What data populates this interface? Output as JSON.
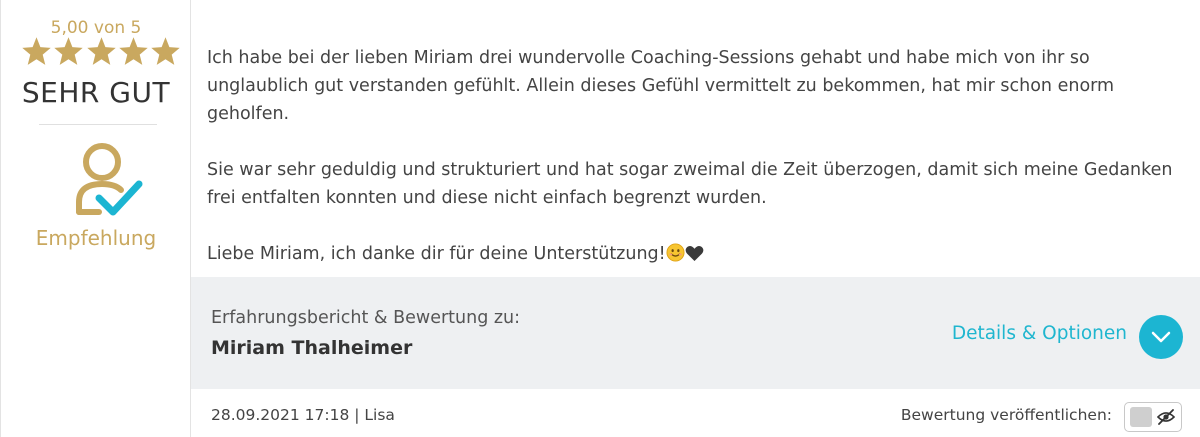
{
  "rating": {
    "score_text": "5,00 von 5",
    "stars": 5,
    "verdict": "SEHR GUT",
    "recommendation_label": "Empfehlung",
    "accent_color": "#c9a85f"
  },
  "review": {
    "paragraphs": [
      "Ich habe bei der lieben Miriam drei wundervolle Coaching-Sessions gehabt und habe mich von ihr so unglaublich gut verstanden gefühlt. Allein dieses Gefühl vermittelt zu bekommen, hat mir schon enorm geholfen.",
      "Sie war sehr geduldig und strukturiert und hat sogar zweimal die Zeit überzogen, damit sich meine Gedanken frei entfalten konnten und diese nicht einfach begrenzt wurden.",
      "Liebe Miriam, ich danke dir für deine Unterstützung!"
    ],
    "emoji_1": "smiling-face-emoji",
    "emoji_2": "heart-icon"
  },
  "panel": {
    "caption": "Erfahrungsbericht & Bewertung zu:",
    "name": "Miriam Thalheimer",
    "details_label": "Details & Optionen",
    "accent_color": "#1cb5d2"
  },
  "footer": {
    "meta": "28.09.2021 17:18 | Lisa",
    "publish_label": "Bewertung veröffentlichen:",
    "toggle_icon": "eye-slash-icon"
  }
}
